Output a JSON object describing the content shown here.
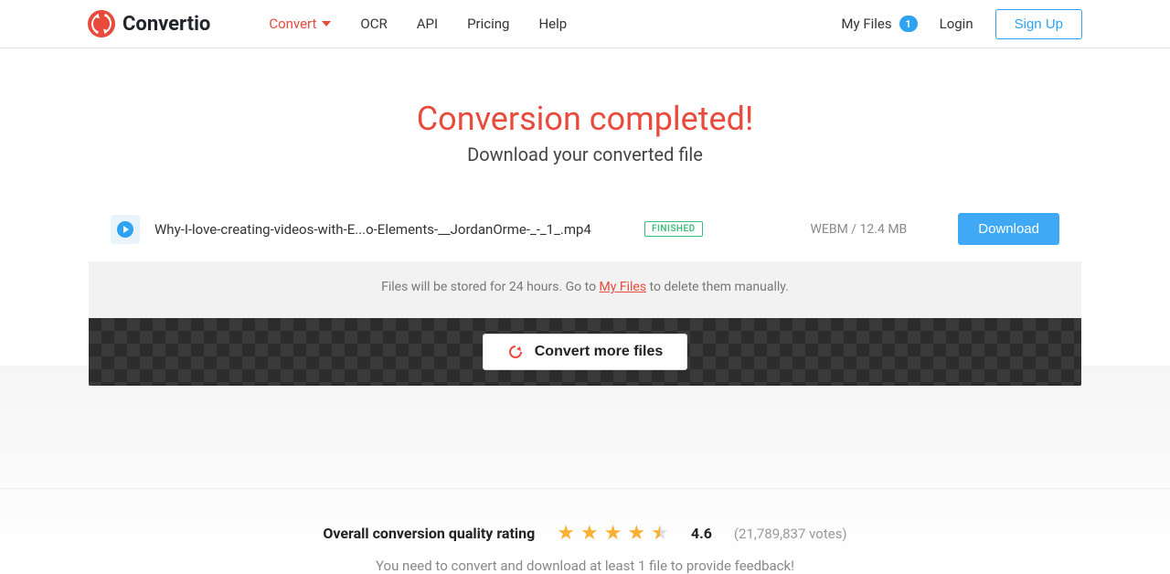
{
  "brand": {
    "name": "Convertio"
  },
  "nav": {
    "convert": "Convert",
    "ocr": "OCR",
    "api": "API",
    "pricing": "Pricing",
    "help": "Help"
  },
  "rightNav": {
    "myFiles": "My Files",
    "badge": "1",
    "login": "Login",
    "signup": "Sign Up"
  },
  "main": {
    "title": "Conversion completed!",
    "subtitle": "Download your converted file"
  },
  "file": {
    "name": "Why-I-love-creating-videos-with-E...o-Elements-__JordanOrme-_-_1_.mp4",
    "status": "FINISHED",
    "meta": "WEBM / 12.4 MB",
    "downloadLabel": "Download"
  },
  "storageNote": {
    "prefix": "Files will be stored for 24 hours. Go to ",
    "link": "My Files",
    "suffix": " to delete them manually."
  },
  "convertMore": "Convert more files",
  "rating": {
    "label": "Overall conversion quality rating",
    "value": "4.6",
    "count": "(21,789,837 votes)",
    "note": "You need to convert and download at least 1 file to provide feedback!"
  }
}
